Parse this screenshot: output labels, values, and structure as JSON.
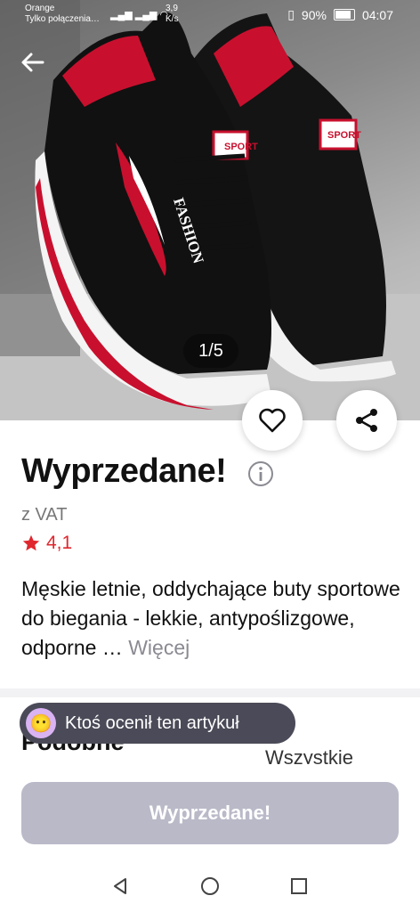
{
  "status_bar": {
    "carrier_line1": "Orange",
    "carrier_line2": "Tylko połączenia…",
    "speed_value": "3,9",
    "speed_unit": "K/s",
    "battery": "90%",
    "time": "04:07"
  },
  "gallery": {
    "counter": "1/5",
    "shoe_brand_side": "FASHION",
    "shoe_tag": "SPORT",
    "shoe_tag_sub": "FASHION"
  },
  "product": {
    "title": "Wyprzedane!",
    "vat": "z VAT",
    "rating": "4,1",
    "description": "Męskie letnie, oddychające buty sportowe do biegania - lekkie, antypoślizgowe, odporne …",
    "more_label": "Więcej"
  },
  "toast": {
    "text": "Ktoś ocenił ten artykuł",
    "avatar_emoji": "😶"
  },
  "similar": {
    "title": "Podobne",
    "all_label": "Wszystkie"
  },
  "cta": {
    "label": "Wyprzedane!"
  },
  "colors": {
    "accent_red": "#e0272e",
    "disabled_button": "#b9b9c8",
    "toast_bg": "#4a4a58"
  },
  "icons": [
    "back-arrow-icon",
    "heart-icon",
    "share-icon",
    "info-icon",
    "star-icon",
    "nav-back-icon",
    "nav-home-icon",
    "nav-recents-icon"
  ]
}
